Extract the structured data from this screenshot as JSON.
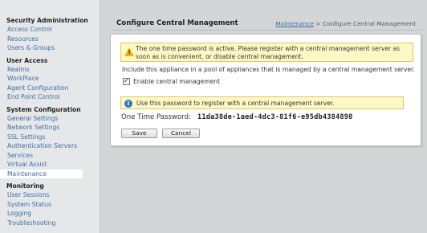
{
  "sidebar": {
    "sections": [
      {
        "heading": "Security Administration",
        "items": [
          "Access Control",
          "Resources",
          "Users & Groups"
        ]
      },
      {
        "heading": "User Access",
        "items": [
          "Realms",
          "WorkPlace",
          "Agent Configuration",
          "End Point Control"
        ]
      },
      {
        "heading": "System Configuration",
        "items": [
          "General Settings",
          "Network Settings",
          "SSL Settings",
          "Authentication Servers",
          "Services",
          "Virtual Assist",
          "Maintenance"
        ]
      },
      {
        "heading": "Monitoring",
        "items": [
          "User Sessions",
          "System Status",
          "Logging",
          "Troubleshooting"
        ]
      }
    ],
    "active_item": "Maintenance"
  },
  "header": {
    "title": "Configure Central Management",
    "breadcrumb_link": "Maintenance",
    "breadcrumb_sep": ">",
    "breadcrumb_current": "Configure Central Management"
  },
  "panel": {
    "warning_text": "The one time password is active.  Please register with a central management server as soon as is convenient, or disable central management.",
    "pool_text": "Include this appliance in a pool of appliances that is managed by a central management server.",
    "checkbox_label": "Enable central management",
    "checkbox_checked": true,
    "info_text": "Use this password to register with a central management server.",
    "otp_label": "One Time Password:",
    "otp_value": "11da38de-1aed-4dc3-81f6-e95db4384898",
    "save_label": "Save",
    "cancel_label": "Cancel"
  },
  "colors": {
    "link": "#3b6fa8",
    "notice_bg": "#fff8c4",
    "warning_icon": "#f0b400",
    "info_icon": "#2d78c8"
  },
  "icons": {
    "warning": "warning-triangle-icon",
    "info": "info-circle-icon"
  }
}
